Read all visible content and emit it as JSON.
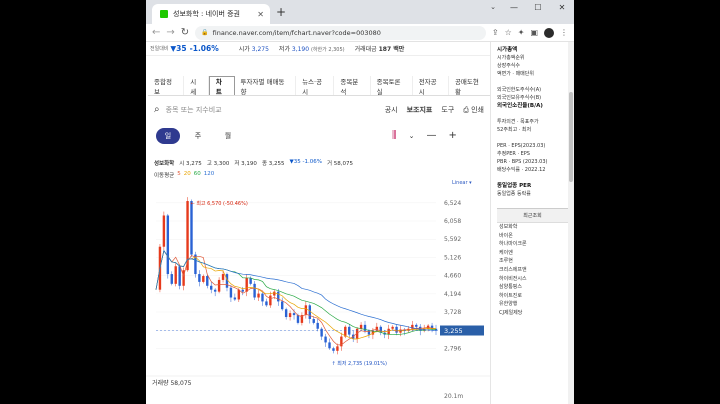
{
  "browser": {
    "tab_title": "성보화학 : 네이버 증권",
    "url": "finance.naver.com/item/fchart.naver?code=003080"
  },
  "pricebar": {
    "prev_label": "전일대비",
    "change": "▼35",
    "change_pct": "-1.06%",
    "high_label": "시가",
    "high": "3,275",
    "low_label": "저가",
    "low": "3,190",
    "limit_label": "(하한가 2,305)",
    "vol_label": "거래대금",
    "vol": "187 백만"
  },
  "subtabs": [
    "종합정보",
    "시세",
    "차트",
    "투자자별 매매동향",
    "뉴스·공시",
    "종목분석",
    "종목토론실",
    "전자공시",
    "공매도현황"
  ],
  "tools": {
    "search_placeholder": "종목 또는 지수비교",
    "notice": "공시",
    "aux": "보조지표",
    "tool": "도구",
    "print": "인쇄"
  },
  "period": [
    "일",
    "주",
    "월"
  ],
  "info": {
    "name": "성보화학",
    "open": "시 3,275",
    "high": "고 3,300",
    "low": "저 3,190",
    "close": "종 3,255",
    "chg": "▼35 -1.06%",
    "vol": "거 58,075"
  },
  "ma": {
    "label": "이동평균",
    "v1": "5",
    "v2": "20",
    "v3": "60",
    "v4": "120",
    "c1": "#e05a3a",
    "c2": "#e8a400",
    "c3": "#27a844",
    "c4": "#2c6fd1"
  },
  "linear": "Linear ▾",
  "chart_data": {
    "type": "line",
    "title": "",
    "yticks": [
      "6,524",
      "6,058",
      "5,592",
      "5,126",
      "4,660",
      "4,194",
      "3,728",
      "3,262",
      "2,796"
    ],
    "ylim": [
      2500,
      6750
    ],
    "last_price": "3,255",
    "high_annot": "최고 6,570 (-50.46%)",
    "low_annot": "최저 2,735 (19.01%)",
    "volume_label": "거래량 58,075",
    "volume_tick": "20.1m",
    "series": [
      {
        "values": [
          4300,
          5400,
          6200,
          4700,
          4450,
          4900,
          4400,
          4800,
          6570,
          5200,
          4700,
          4500,
          4650,
          4400,
          4300,
          4250,
          4550,
          4700,
          4350,
          4100,
          4050,
          4300,
          4250,
          4600,
          4450,
          4100,
          4200,
          4000,
          3900,
          4150,
          4250,
          4000,
          3800,
          3600,
          3700,
          3650,
          3450,
          3650,
          3900,
          3550,
          3450,
          3300,
          3100,
          2950,
          2800,
          2735,
          2850,
          3100,
          3350,
          3150,
          3050,
          3300,
          3400,
          3250,
          3150,
          3250,
          3350,
          3200,
          3150,
          3300,
          3350,
          3200,
          3280,
          3250,
          3300,
          3400,
          3350,
          3250,
          3300,
          3380,
          3300,
          3255
        ]
      }
    ]
  },
  "side": {
    "s1": [
      "시가총액",
      "시가총액순위",
      "상장주식수",
      "액면가 · 매매단위"
    ],
    "s2": [
      "외국인한도주식수(A)",
      "외국인보유주식수(B)",
      "외국인소진율(B/A)"
    ],
    "s3": [
      "투자의견 · 목표주가",
      "52주최고 · 최저"
    ],
    "s4": [
      "PER · EPS(2023.03)",
      "추정PER · EPS",
      "PBR · BPS (2023.03)",
      "배당수익률 · 2022.12"
    ],
    "s5": [
      "동일업종 PER",
      "동일업종 등락률"
    ],
    "recent_title": "최근조회",
    "recent": [
      "성보화학",
      "바이온",
      "하나마이크론",
      "케이엔",
      "조루현",
      "크리스에프앤",
      "하이비전시스",
      "삼양통핑스",
      "하이트진로",
      "유한양행",
      "CJ제일제당"
    ]
  }
}
